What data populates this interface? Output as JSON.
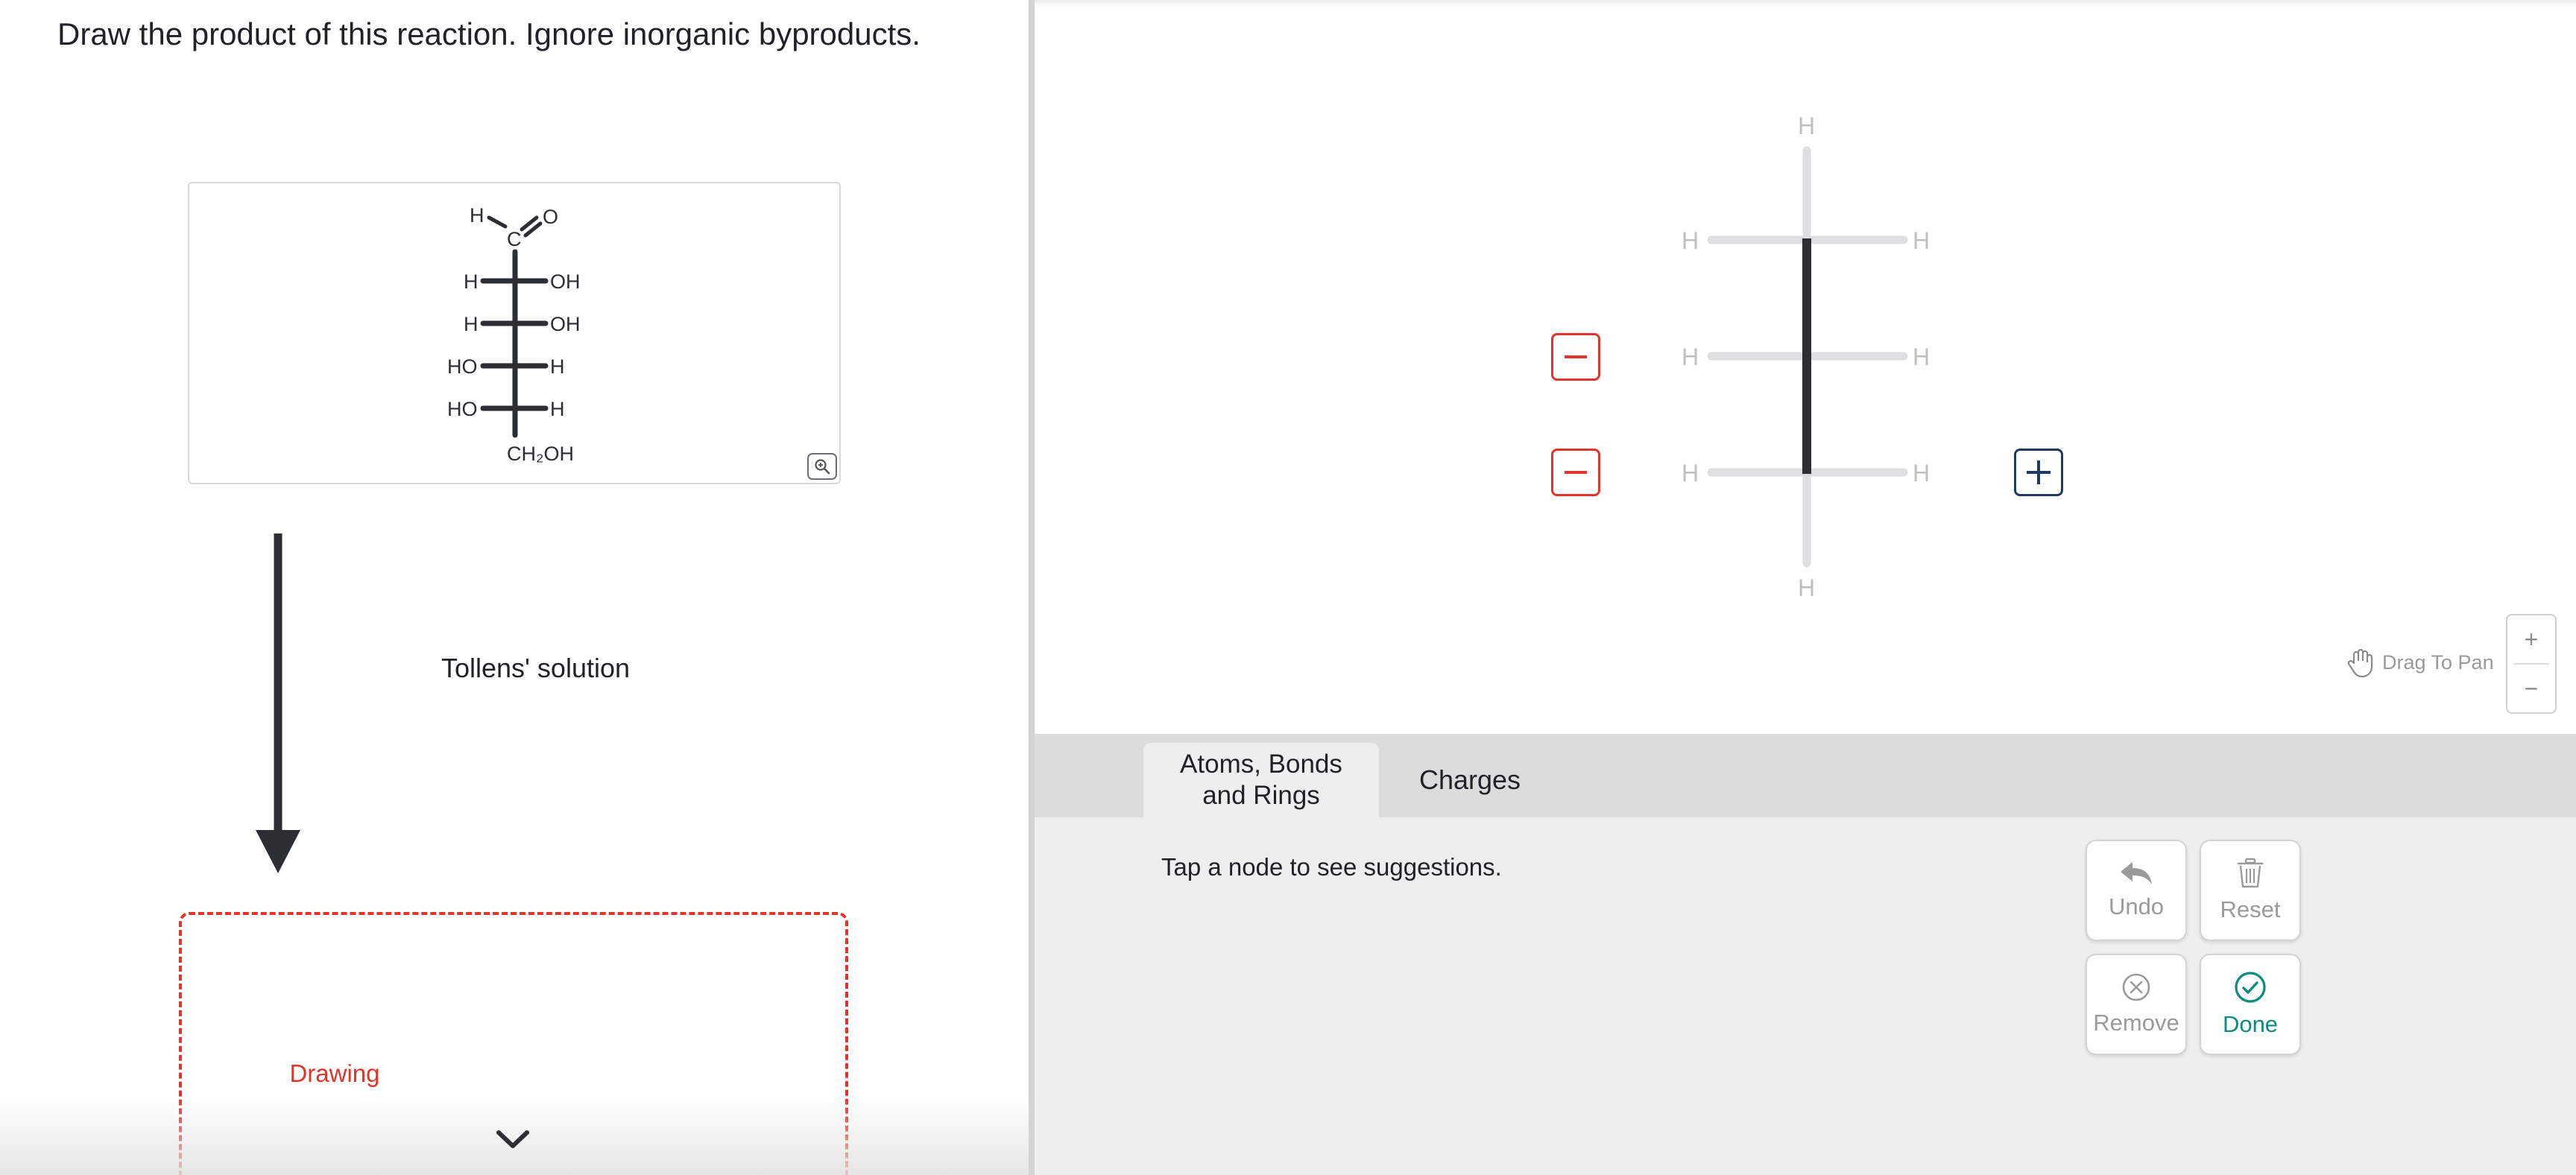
{
  "question": {
    "text": "Draw the product of this reaction. Ignore inorganic byproducts."
  },
  "reactant": {
    "top_h": "H",
    "carbonyl_c": "C",
    "carbonyl_o": "O",
    "rows": [
      {
        "left": "H",
        "right": "OH"
      },
      {
        "left": "H",
        "right": "OH"
      },
      {
        "left": "HO",
        "right": "H"
      },
      {
        "left": "HO",
        "right": "H"
      }
    ],
    "bottom": "CH₂OH",
    "zoom_icon": "magnifier-plus-icon"
  },
  "reagent": {
    "label": "Tollens' solution"
  },
  "drawing": {
    "label": "Drawing",
    "chevron_icon": "chevron-down-icon"
  },
  "editor": {
    "atom_labels": {
      "top": "H",
      "bottom": "H",
      "row1_left": "H",
      "row1_right": "H",
      "row2_left": "H",
      "row2_right": "H",
      "row3_left": "H",
      "row3_right": "H"
    },
    "drag_to_pan": "Drag To Pan",
    "zoom_in": "+",
    "zoom_out": "−"
  },
  "tabs": [
    {
      "label": "Atoms, Bonds\nand Rings",
      "active": true
    },
    {
      "label": "Charges",
      "active": false
    }
  ],
  "panel": {
    "hint": "Tap a node to see suggestions.",
    "actions": {
      "undo": "Undo",
      "reset": "Reset",
      "remove": "Remove",
      "done": "Done"
    }
  },
  "colors": {
    "accent_red": "#e0352b",
    "accent_navy": "#1e3a5f",
    "done_teal": "#0d8c7a",
    "bond_dark": "#2b2e33",
    "bond_light": "#dedfe1"
  }
}
